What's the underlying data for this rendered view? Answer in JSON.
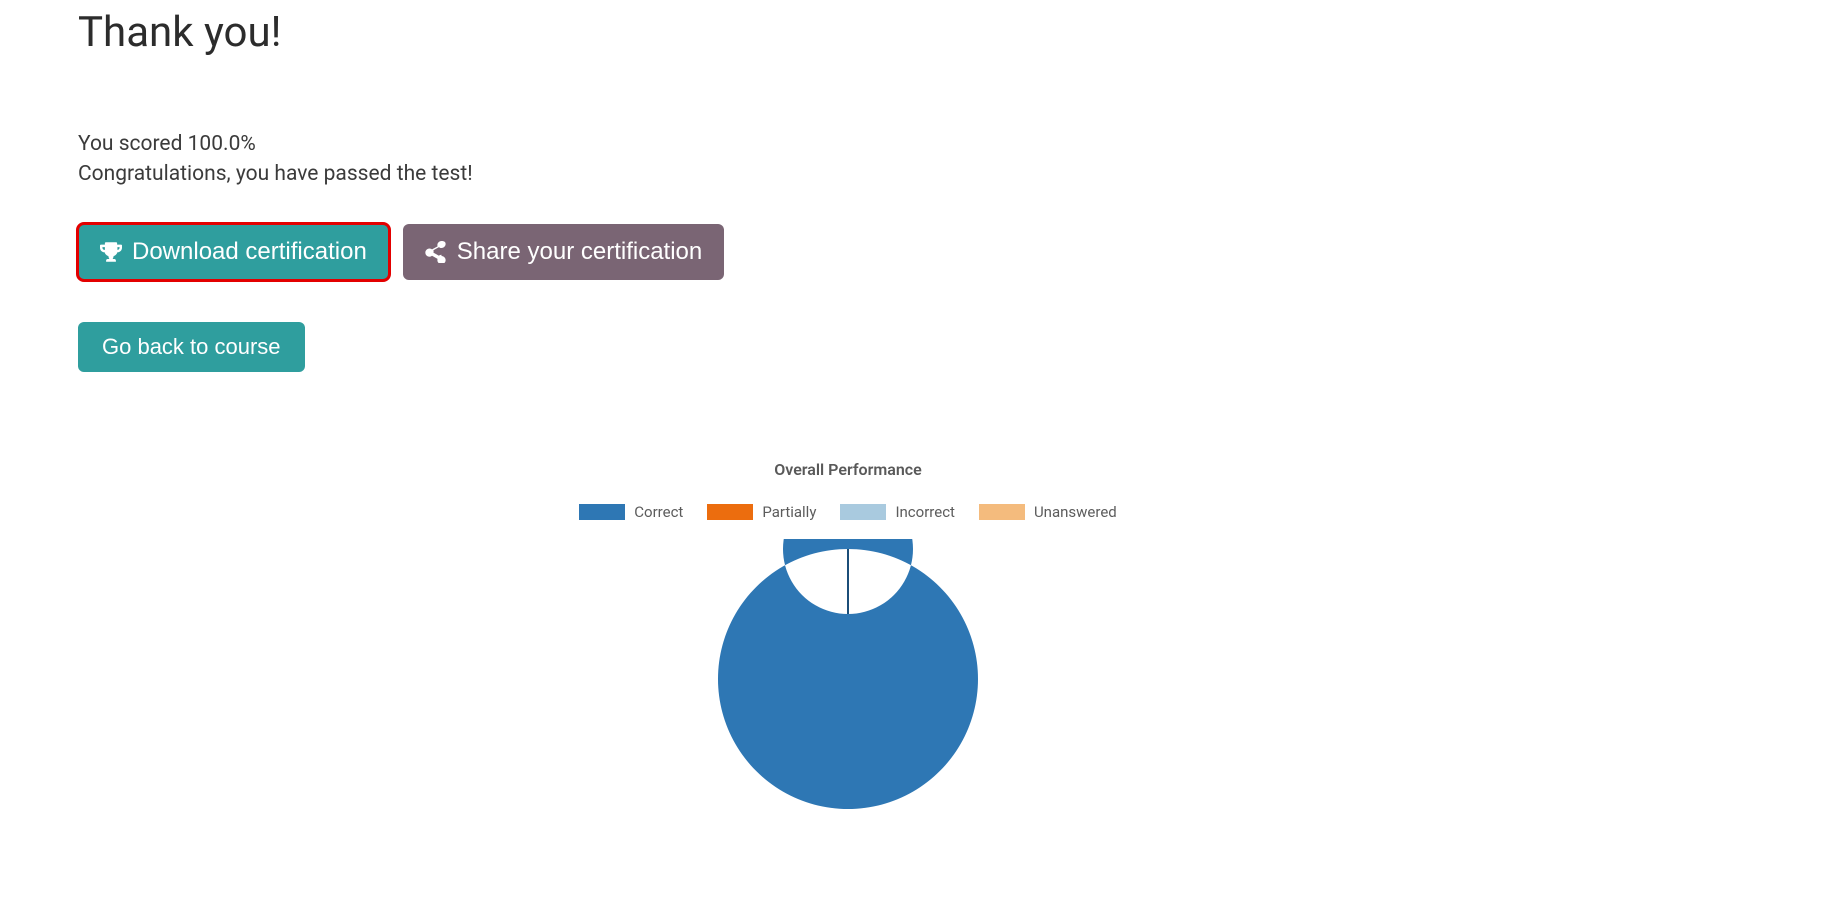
{
  "page": {
    "title": "Thank you!",
    "score_line": "You scored 100.0%",
    "congrats_line": "Congratulations, you have passed the test!"
  },
  "buttons": {
    "download_cert": " Download certification",
    "share_cert": " Share your certification",
    "go_back": "Go back to course"
  },
  "chart": {
    "title": "Overall Performance",
    "legend": {
      "correct": {
        "label": "Correct",
        "color": "#2e77b4"
      },
      "partially": {
        "label": "Partially",
        "color": "#ec6d0e"
      },
      "incorrect": {
        "label": "Incorrect",
        "color": "#a9cadf"
      },
      "unanswered": {
        "label": "Unanswered",
        "color": "#f4bb7d"
      }
    }
  },
  "chart_data": {
    "type": "pie",
    "title": "Overall Performance",
    "categories": [
      "Correct",
      "Partially",
      "Incorrect",
      "Unanswered"
    ],
    "values": [
      100,
      0,
      0,
      0
    ],
    "series": [
      {
        "name": "Correct",
        "value": 100,
        "color": "#2e77b4"
      },
      {
        "name": "Partially",
        "value": 0,
        "color": "#ec6d0e"
      },
      {
        "name": "Incorrect",
        "value": 0,
        "color": "#a9cadf"
      },
      {
        "name": "Unanswered",
        "value": 0,
        "color": "#f4bb7d"
      }
    ],
    "donut": true,
    "inner_radius_ratio": 0.5
  }
}
